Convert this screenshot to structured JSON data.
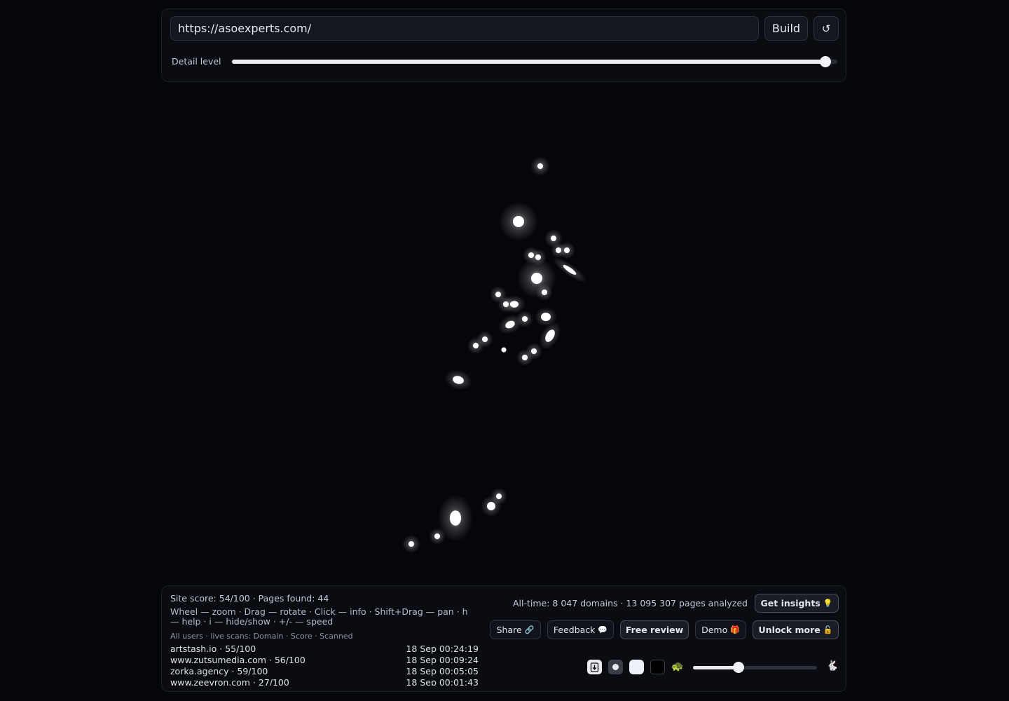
{
  "controls": {
    "url_value": "https://asoexperts.com/",
    "build_label": "Build",
    "refresh_icon": "refresh-icon",
    "refresh_glyph": "↺",
    "detail_label": "Detail level",
    "detail_level": 0.98
  },
  "stats": {
    "site_score": "Site score: 54/100 · Pages found: 44",
    "help": "Wheel — zoom · Drag — rotate · Click — info · Shift+Drag — pan · h — help · i — hide/show · +/- — speed",
    "scans_header": "All users · live scans: Domain · Score · Scanned",
    "alltime": "All-time: 8 047 domains · 13 095 307 pages analyzed"
  },
  "scans": [
    {
      "domain": "artstash.io · 55/100",
      "time": "18 Sep 00:24:19"
    },
    {
      "domain": "www.zutsumedia.com · 56/100",
      "time": "18 Sep 00:09:24"
    },
    {
      "domain": "zorka.agency · 59/100",
      "time": "18 Sep 00:05:05"
    },
    {
      "domain": "www.zeevron.com · 27/100",
      "time": "18 Sep 00:01:43"
    }
  ],
  "actions": {
    "insights": {
      "label": "Get insights",
      "emoji": "💡"
    },
    "share": {
      "label": "Share",
      "emoji": "🔗"
    },
    "feedback": {
      "label": "Feedback",
      "emoji": "💬"
    },
    "free_review": {
      "label": "Free review"
    },
    "demo": {
      "label": "Demo",
      "emoji": "🎁"
    },
    "unlock": {
      "label": "Unlock more",
      "emoji": "🔓"
    }
  },
  "playback": {
    "slow_emoji": "🐢",
    "fast_emoji": "🐇",
    "speed_level": 0.37
  },
  "colors": {
    "background": "#05060a",
    "node": "#ffffff"
  }
}
